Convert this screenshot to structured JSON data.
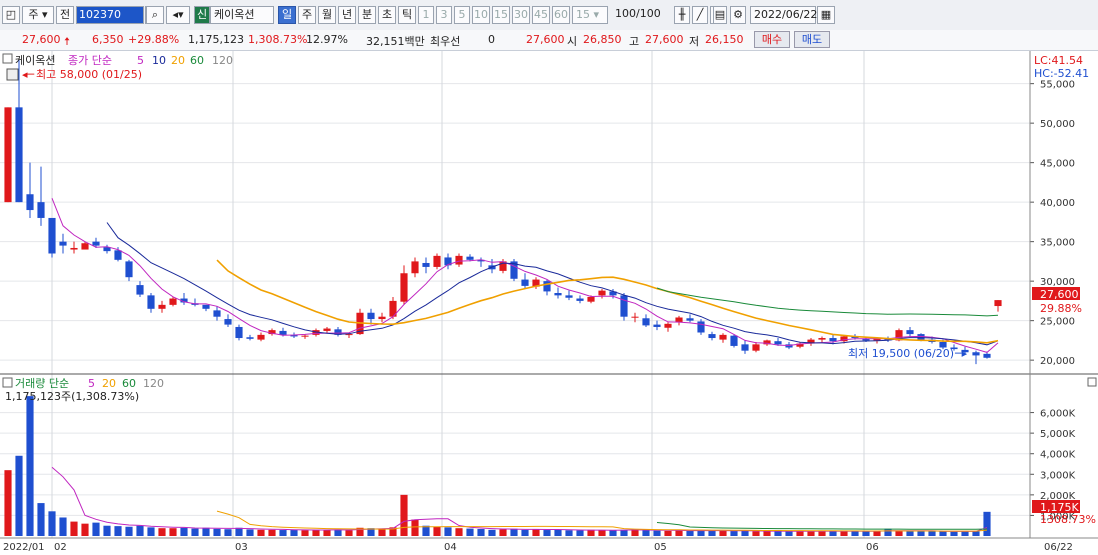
{
  "toolbar": {
    "type_label": "주",
    "prev_label": "전",
    "code": "102370",
    "new_badge": "신",
    "stock_name": "케이옥션",
    "periods": [
      "일",
      "주",
      "월",
      "년",
      "분",
      "초",
      "틱"
    ],
    "period_selected": "일",
    "intervals": [
      "1",
      "3",
      "5",
      "10",
      "15",
      "30",
      "45",
      "60"
    ],
    "interval_value": "15",
    "count": "100",
    "count_total": "/100",
    "date": "2022/06/22"
  },
  "info": {
    "price": "27,600",
    "change": "6,350",
    "change_pct": "+29.88%",
    "volume": "1,175,123",
    "volume_pct": "1,308.73%",
    "turnover": "12.97%",
    "amount": "32,151백만",
    "cred_label": "최우선",
    "cred_value": "0",
    "quote_price": "27,600",
    "open_label": "시",
    "open": "26,850",
    "high_label": "고",
    "high": "27,600",
    "low_label": "저",
    "low": "26,150",
    "buy_label": "매수",
    "sell_label": "매도"
  },
  "price_panel": {
    "name": "케이옥션",
    "ma_label": "종가 단순",
    "ma_periods": [
      "5",
      "10",
      "20",
      "60",
      "120"
    ],
    "ma_colors": [
      "#c026c0",
      "#1a2a9a",
      "#f0a000",
      "#1a8a3a",
      "#888888"
    ],
    "lc": "LC:41.54",
    "hc": "HC:-52.41",
    "max_note": "최고 58,000 (01/25)",
    "min_note": "최저 19,500 (06/20)",
    "last_price": "27,600",
    "last_pct": "29.88%"
  },
  "volume_panel": {
    "title": "거래량 단순",
    "ma_periods": [
      "5",
      "20",
      "60",
      "120"
    ],
    "ma_colors": [
      "#c026c0",
      "#f0a000",
      "#1a8a3a",
      "#888888"
    ],
    "note": "1,175,123주(1,308.73%)",
    "last_volume": "1,175K",
    "last_pct": "1308.73%"
  },
  "x_axis": [
    "2022/01",
    "02",
    "03",
    "04",
    "05",
    "06",
    "06/22"
  ],
  "colors": {
    "up": "#e0181b",
    "down": "#1f4fd0"
  },
  "chart_data": {
    "type": "candlestick",
    "y_ticks": [
      20000,
      25000,
      30000,
      35000,
      40000,
      45000,
      50000,
      55000
    ],
    "y_tick_labels": [
      "20,000",
      "25,000",
      "30,000",
      "35,000",
      "40,000",
      "45,000",
      "50,000",
      "55,000"
    ],
    "vol_ticks": [
      1000,
      2000,
      3000,
      4000,
      5000,
      6000
    ],
    "vol_tick_labels": [
      "1,000K",
      "2,000K",
      "3,000K",
      "4,000K",
      "5,000K",
      "6,000K"
    ],
    "ohlc": [
      [
        40000,
        52000,
        40000,
        52000
      ],
      [
        52000,
        58000,
        40000,
        40000
      ],
      [
        41000,
        45000,
        38000,
        39000
      ],
      [
        40000,
        44500,
        37000,
        38000
      ],
      [
        38000,
        38000,
        33000,
        33500
      ],
      [
        35000,
        36000,
        33500,
        34500
      ],
      [
        34000,
        35000,
        33500,
        34200
      ],
      [
        34000,
        35000,
        34000,
        34800
      ],
      [
        35000,
        35500,
        34200,
        34500
      ],
      [
        34300,
        34600,
        33500,
        33800
      ],
      [
        33900,
        34300,
        32500,
        32700
      ],
      [
        32500,
        32700,
        30000,
        30500
      ],
      [
        29500,
        30000,
        28000,
        28300
      ],
      [
        28200,
        28500,
        26000,
        26500
      ],
      [
        26500,
        27500,
        26000,
        27000
      ],
      [
        27000,
        28000,
        26800,
        27800
      ],
      [
        27800,
        28500,
        27000,
        27300
      ],
      [
        27200,
        27800,
        26800,
        27000
      ],
      [
        27000,
        27000,
        26200,
        26500
      ],
      [
        26300,
        26800,
        25000,
        25500
      ],
      [
        25200,
        25800,
        24200,
        24500
      ],
      [
        24200,
        24500,
        22500,
        22800
      ],
      [
        22900,
        23200,
        22500,
        22700
      ],
      [
        22600,
        23500,
        22400,
        23200
      ],
      [
        23300,
        24000,
        23100,
        23800
      ],
      [
        23700,
        24100,
        23000,
        23200
      ],
      [
        23200,
        23500,
        22800,
        23000
      ],
      [
        23000,
        23300,
        22700,
        23100
      ],
      [
        23200,
        24000,
        23000,
        23800
      ],
      [
        23700,
        24200,
        23400,
        24000
      ],
      [
        23900,
        24200,
        23000,
        23200
      ],
      [
        23200,
        23500,
        22800,
        23300
      ],
      [
        23300,
        26500,
        23200,
        26000
      ],
      [
        26000,
        26500,
        24500,
        25200
      ],
      [
        25200,
        26000,
        24800,
        25500
      ],
      [
        25500,
        28000,
        25200,
        27500
      ],
      [
        27400,
        32000,
        27000,
        31000
      ],
      [
        31000,
        33000,
        30500,
        32500
      ],
      [
        32300,
        33000,
        31000,
        31800
      ],
      [
        31800,
        33500,
        31500,
        33200
      ],
      [
        33000,
        33500,
        31500,
        32000
      ],
      [
        32100,
        33500,
        31800,
        33200
      ],
      [
        33100,
        33400,
        32500,
        32700
      ],
      [
        32700,
        33000,
        31800,
        32500
      ],
      [
        32000,
        32800,
        31000,
        31500
      ],
      [
        31300,
        32800,
        31000,
        32500
      ],
      [
        32500,
        32800,
        30000,
        30300
      ],
      [
        30200,
        31000,
        29000,
        29400
      ],
      [
        29300,
        30500,
        29000,
        30200
      ],
      [
        30000,
        30200,
        28200,
        28700
      ],
      [
        28500,
        29200,
        27800,
        28200
      ],
      [
        28200,
        28800,
        27600,
        27900
      ],
      [
        27800,
        28200,
        27200,
        27500
      ],
      [
        27400,
        28200,
        27200,
        28000
      ],
      [
        28200,
        29000,
        27800,
        28800
      ],
      [
        28700,
        29000,
        27800,
        28200
      ],
      [
        28200,
        28500,
        25000,
        25500
      ],
      [
        25400,
        26000,
        24800,
        25500
      ],
      [
        25300,
        25800,
        24200,
        24400
      ],
      [
        24500,
        25000,
        23800,
        24200
      ],
      [
        24100,
        24800,
        23600,
        24600
      ],
      [
        24800,
        25600,
        24400,
        25400
      ],
      [
        25300,
        25800,
        24800,
        25000
      ],
      [
        24900,
        25200,
        23200,
        23500
      ],
      [
        23300,
        23600,
        22500,
        22800
      ],
      [
        22600,
        23400,
        22200,
        23200
      ],
      [
        23100,
        23300,
        21600,
        21800
      ],
      [
        22000,
        22500,
        20800,
        21200
      ],
      [
        21200,
        22300,
        21000,
        22000
      ],
      [
        22000,
        22600,
        21800,
        22500
      ],
      [
        22400,
        22800,
        21800,
        22000
      ],
      [
        22000,
        22300,
        21400,
        21600
      ],
      [
        21700,
        22300,
        21500,
        22100
      ],
      [
        22100,
        22800,
        21800,
        22600
      ],
      [
        22600,
        23000,
        22200,
        22800
      ],
      [
        22800,
        23200,
        22000,
        22400
      ],
      [
        22400,
        23100,
        22100,
        23000
      ],
      [
        23000,
        23300,
        22600,
        22800
      ],
      [
        22700,
        23000,
        22300,
        22500
      ],
      [
        22500,
        22900,
        22100,
        22800
      ],
      [
        22800,
        23000,
        22300,
        22500
      ],
      [
        22500,
        24000,
        22400,
        23800
      ],
      [
        23800,
        24200,
        23000,
        23300
      ],
      [
        23300,
        23400,
        22400,
        22600
      ],
      [
        22600,
        23000,
        22100,
        22300
      ],
      [
        22300,
        22600,
        21400,
        21600
      ],
      [
        21600,
        22000,
        21200,
        21400
      ],
      [
        21300,
        21700,
        20800,
        21000
      ],
      [
        21000,
        21200,
        19500,
        20600
      ],
      [
        20800,
        21100,
        20200,
        20300
      ],
      [
        26850,
        27600,
        26150,
        27600
      ]
    ],
    "volume_k": [
      3200,
      3900,
      6800,
      1600,
      1200,
      900,
      700,
      600,
      650,
      500,
      480,
      450,
      500,
      420,
      380,
      380,
      400,
      360,
      400,
      350,
      330,
      400,
      320,
      300,
      300,
      290,
      310,
      280,
      290,
      300,
      320,
      280,
      400,
      380,
      360,
      420,
      2000,
      800,
      500,
      450,
      420,
      380,
      360,
      340,
      300,
      320,
      350,
      300,
      330,
      290,
      300,
      280,
      270,
      300,
      280,
      290,
      300,
      310,
      280,
      260,
      250,
      270,
      260,
      280,
      250,
      260,
      240,
      250,
      230,
      220,
      240,
      230,
      220,
      240,
      230,
      260,
      220,
      240,
      220,
      230,
      350,
      250,
      240,
      220,
      230,
      220,
      210,
      240,
      230,
      1175
    ]
  }
}
